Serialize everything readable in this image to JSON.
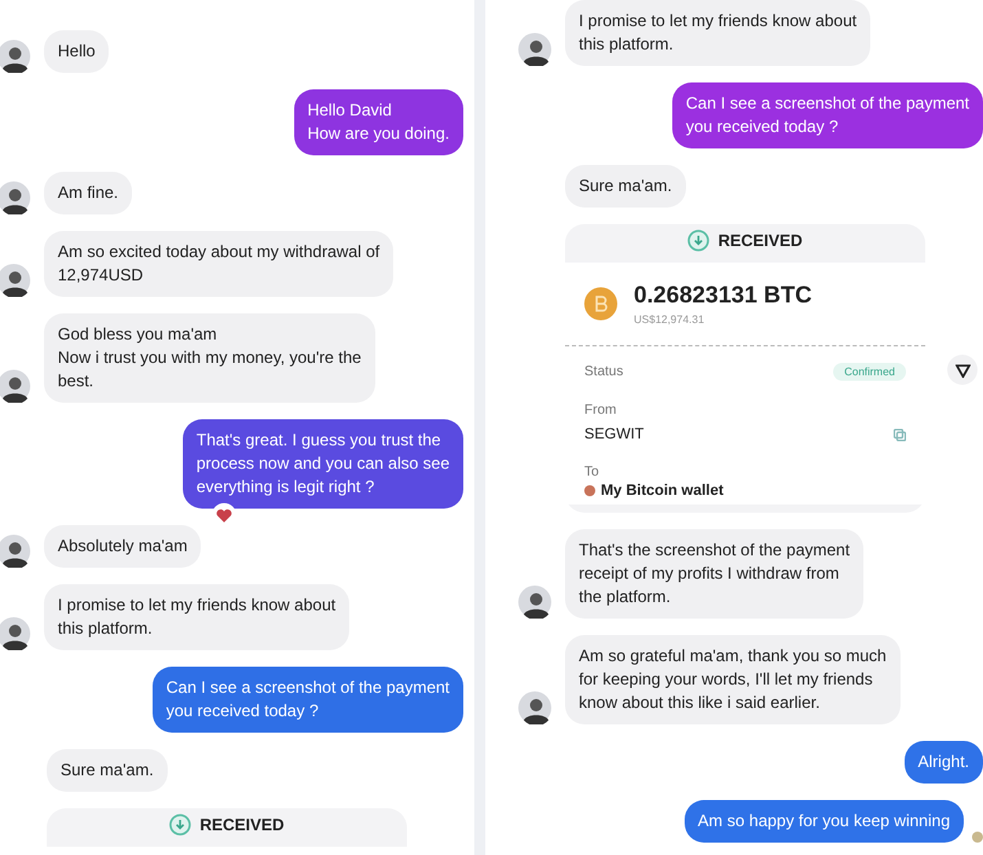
{
  "panels": [
    {
      "messages": [
        {
          "kind": "incoming",
          "text": "Hello",
          "avatar": true
        },
        {
          "kind": "outgoing",
          "lines": [
            "Hello David",
            "How are you doing."
          ],
          "color": "#8e34e0"
        },
        {
          "kind": "incoming",
          "text": "Am fine.",
          "avatar": true
        },
        {
          "kind": "incoming",
          "lines": [
            "Am so excited today about my withdrawal of",
            "12,974USD"
          ],
          "avatar": true
        },
        {
          "kind": "incoming",
          "lines": [
            "God bless you ma'am",
            "Now i trust you with my money, you're the",
            "best."
          ],
          "avatar": true
        },
        {
          "kind": "outgoing",
          "lines": [
            "That's great. I guess you trust the",
            "process now and you can also see",
            "everything is legit right ?"
          ],
          "color": "#5a4be0",
          "reacted": true
        },
        {
          "kind": "incoming",
          "text": "Absolutely ma'am",
          "avatar": true
        },
        {
          "kind": "incoming",
          "lines": [
            "I promise to let my friends know about",
            "this platform."
          ],
          "avatar": true
        },
        {
          "kind": "outgoing",
          "lines": [
            "Can I see a screenshot of the payment",
            "you received today ?"
          ],
          "color": "#2f6fe6"
        },
        {
          "kind": "incoming",
          "text": "Sure ma'am.",
          "avatar": false
        },
        {
          "kind": "receipt",
          "title": "RECEIVED"
        }
      ]
    },
    {
      "messages": [
        {
          "kind": "incoming",
          "lines": [
            "I promise to let my friends know about",
            "this platform."
          ],
          "avatar": true
        },
        {
          "kind": "outgoing",
          "lines": [
            "Can I see a screenshot of the payment",
            "you received today ?"
          ],
          "color": "#9b30e0"
        },
        {
          "kind": "incoming",
          "text": "Sure ma'am.",
          "avatar": false
        },
        {
          "kind": "receipt",
          "title": "RECEIVED",
          "amount": "0.26823131 BTC",
          "fiat": "US$12,974.31",
          "status_label": "Status",
          "status": "Confirmed",
          "from_label": "From",
          "from": "SEGWIT",
          "to_label": "To",
          "to": {
            "label": "My Bitcoin wallet",
            "color": "#c8735a"
          }
        },
        {
          "kind": "incoming",
          "lines": [
            "That's the screenshot of the payment",
            "receipt of my profits I withdraw from",
            "the platform."
          ],
          "avatar": true
        },
        {
          "kind": "incoming",
          "lines": [
            "Am so grateful ma'am, thank you so much",
            "for keeping your words, I'll let my friends",
            "know about this like i said earlier."
          ],
          "avatar": true
        },
        {
          "kind": "outgoing",
          "text": "Alright.",
          "color": "#2f72e8"
        },
        {
          "kind": "outgoing",
          "text": "Am so happy for you keep winning",
          "color": "#2f72e8",
          "seen": true
        }
      ]
    }
  ]
}
